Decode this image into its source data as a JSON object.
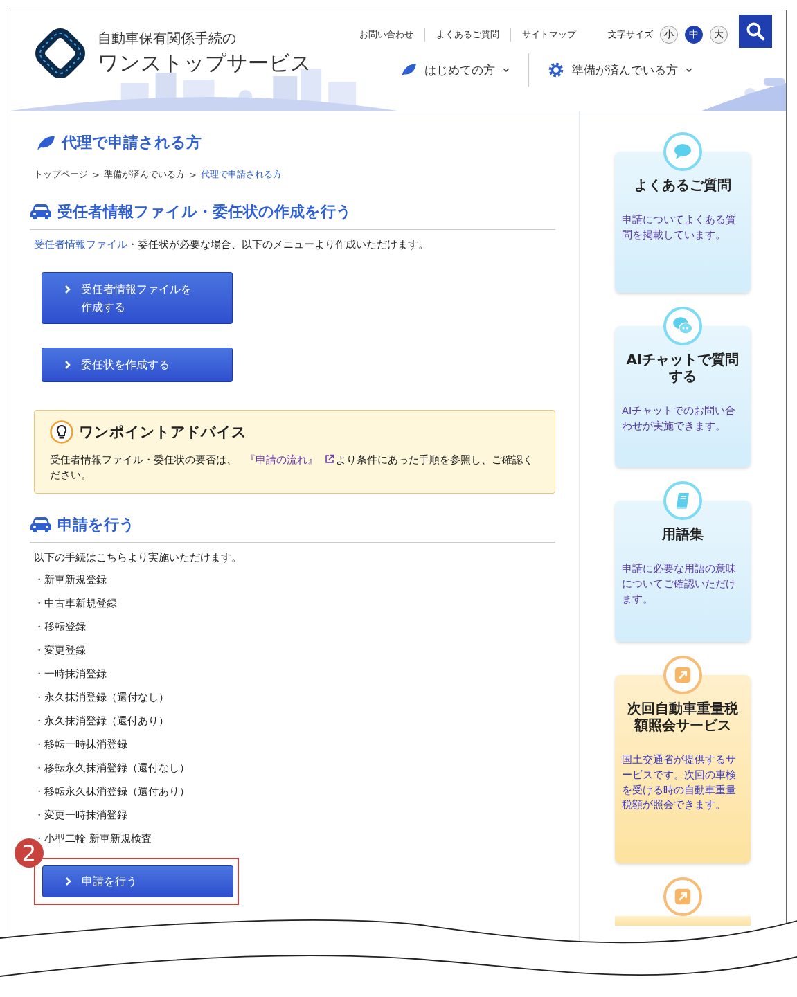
{
  "header": {
    "logo_line1": "自動車保有関係手続の",
    "logo_line2": "ワンストップサービス",
    "utility_links": [
      "お問い合わせ",
      "よくあるご質問",
      "サイトマップ"
    ],
    "font_size_label": "文字サイズ",
    "font_sizes": [
      {
        "label": "小",
        "selected": false
      },
      {
        "label": "中",
        "selected": true
      },
      {
        "label": "大",
        "selected": false
      }
    ],
    "nav": [
      {
        "label": "はじめての方",
        "kind": "leaf"
      },
      {
        "label": "準備が済んでいる方",
        "kind": "gear"
      }
    ]
  },
  "page_title": "代理で申請される方",
  "breadcrumb": [
    {
      "label": "トップページ",
      "separator": ">",
      "current": false
    },
    {
      "label": "準備が済んでいる方",
      "separator": ">",
      "current": false
    },
    {
      "label": "代理で申請される方",
      "current": true
    }
  ],
  "section1": {
    "heading": "受任者情報ファイル・委任状の作成を行う",
    "intro_link": "受任者情報ファイル",
    "intro_rest": "・委任状が必要な場合、以下のメニューより作成いただけます。",
    "buttons": [
      "受任者情報ファイルを作成する",
      "委任状を作成する"
    ]
  },
  "advice": {
    "title": "ワンポイントアドバイス",
    "text_before": "受任者情報ファイル・委任状の要否は、",
    "link": "『申請の流れ』",
    "text_after": "より条件にあった手順を参照し、ご確認ください。"
  },
  "section2": {
    "heading": "申請を行う",
    "intro": "以下の手続はこちらより実施いただけます。",
    "items": [
      "・新車新規登録",
      "・中古車新規登録",
      "・移転登録",
      "・変更登録",
      "・一時抹消登録",
      "・永久抹消登録（還付なし）",
      "・永久抹消登録（還付あり）",
      "・移転一時抹消登録",
      "・移転永久抹消登録（還付なし）",
      "・移転永久抹消登録（還付あり）",
      "・変更一時抹消登録",
      "・小型二輪 新車新規検査"
    ],
    "button": "申請を行う",
    "callout_number": "2"
  },
  "sidebar": [
    {
      "kind": "faq",
      "title": "よくあるご質問",
      "text": "申請についてよくある質問を掲載しています。"
    },
    {
      "kind": "chat",
      "title": "AIチャットで質問する",
      "text": "AIチャットでのお問い合わせが実施できます。"
    },
    {
      "kind": "glossary",
      "title": "用語集",
      "text": "申請に必要な用語の意味についてご確認いただけます。"
    },
    {
      "kind": "external",
      "title": "次回自動車重量税額照会サービス",
      "text": "国土交通省が提供するサービスです。次回の車検を受ける時の自動車重量税額が照会できます。"
    },
    {
      "kind": "external"
    }
  ]
}
